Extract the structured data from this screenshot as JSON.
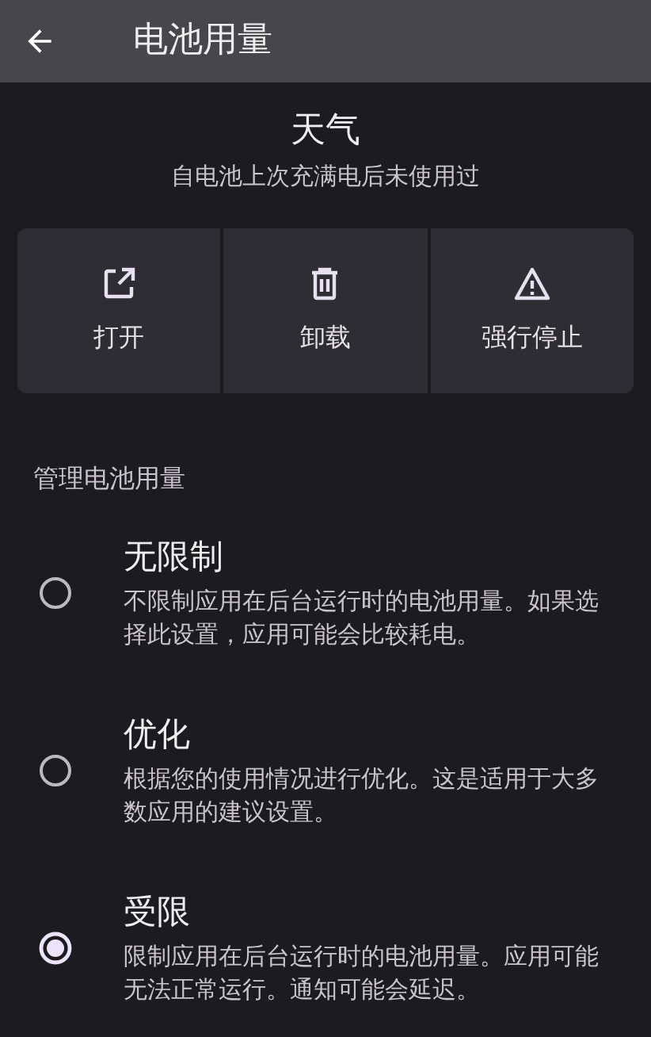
{
  "app_bar": {
    "title": "电池用量"
  },
  "app": {
    "name": "天气",
    "summary": "自电池上次充满电后未使用过"
  },
  "actions": [
    {
      "kind": "open",
      "label": "打开"
    },
    {
      "kind": "uninstall",
      "label": "卸载"
    },
    {
      "kind": "force_stop",
      "label": "强行停止"
    }
  ],
  "section": {
    "title": "管理电池用量"
  },
  "options": [
    {
      "title": "无限制",
      "description": "不限制应用在后台运行时的电池用量。如果选择此设置，应用可能会比较耗电。",
      "selected": false
    },
    {
      "title": "优化",
      "description": "根据您的使用情况进行优化。这是适用于大多数应用的建议设置。",
      "selected": false
    },
    {
      "title": "受限",
      "description": "限制应用在后台运行时的电池用量。应用可能无法正常运行。通知可能会延迟。",
      "selected": true
    }
  ]
}
